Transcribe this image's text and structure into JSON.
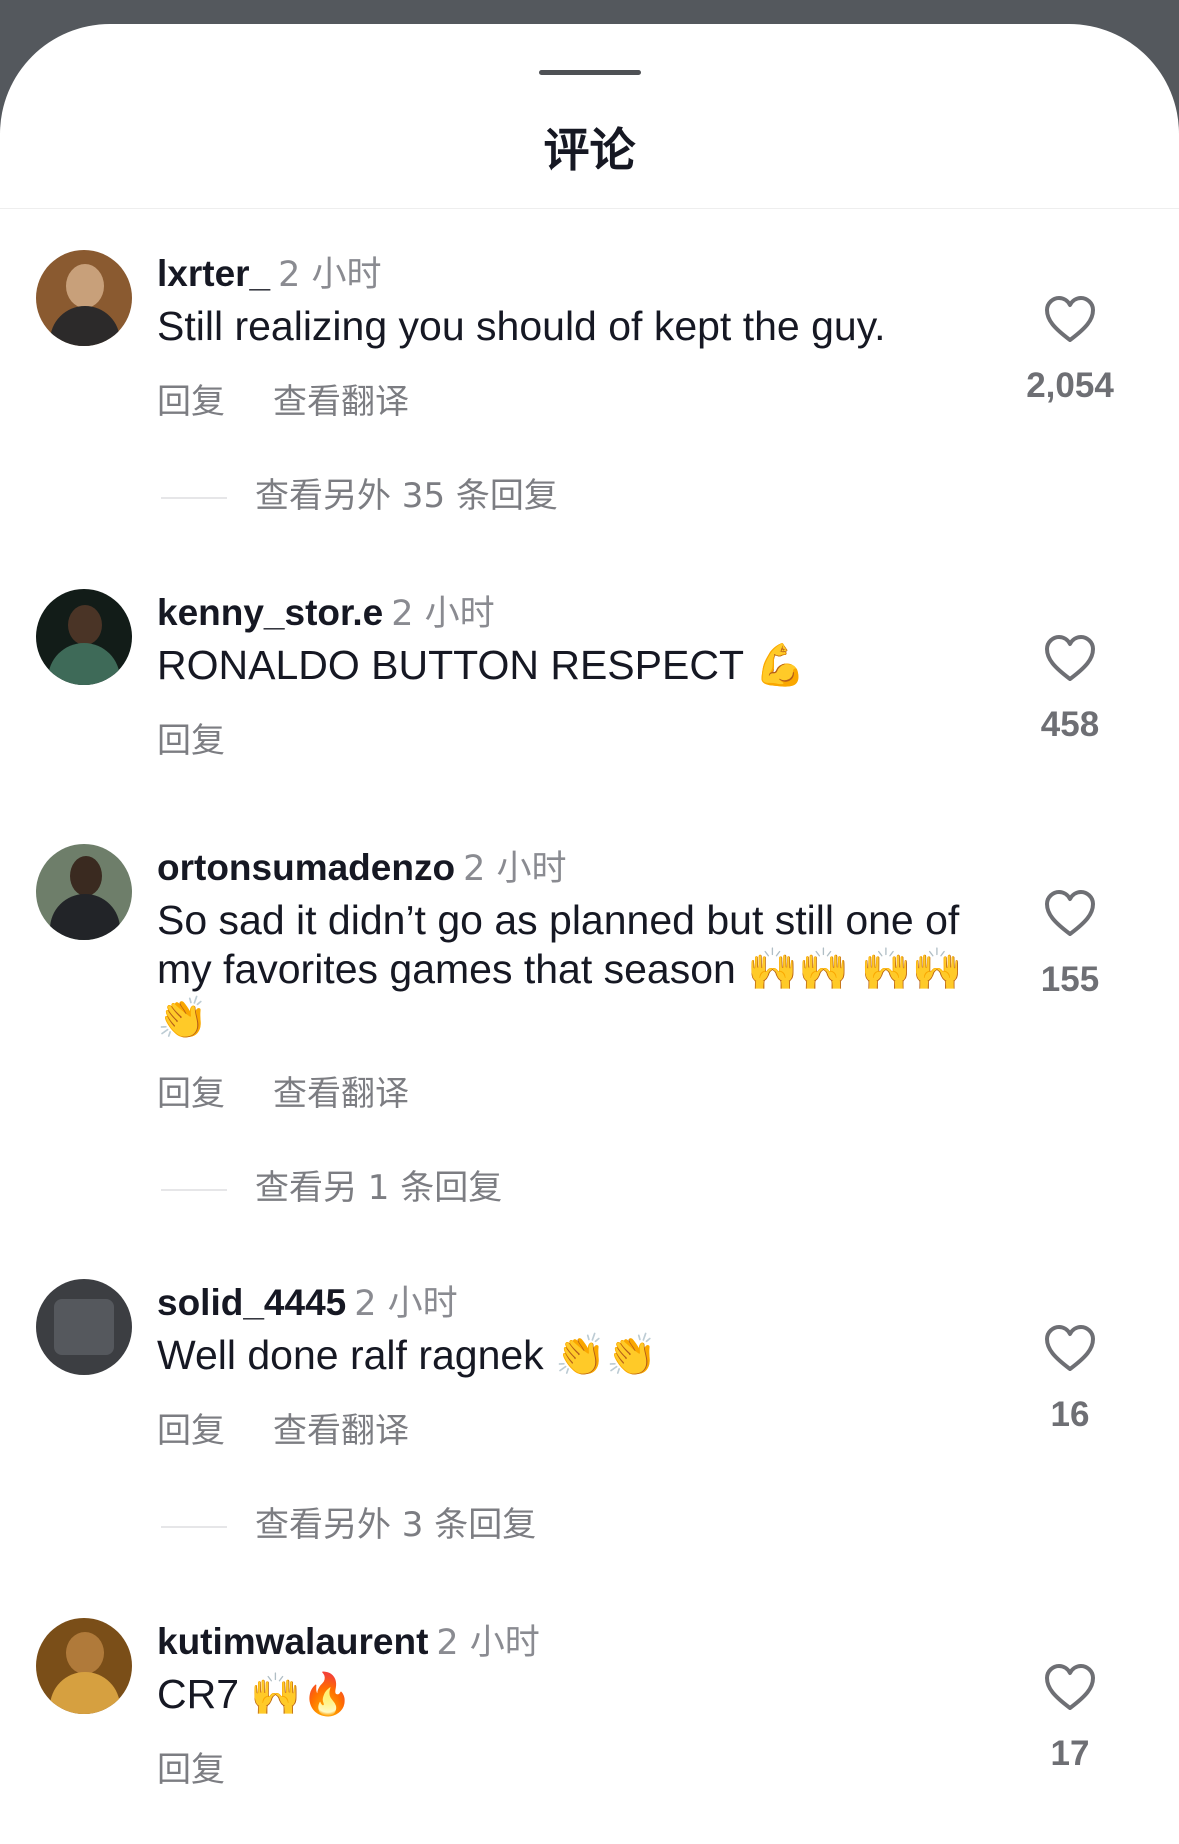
{
  "title": "评论",
  "actions": {
    "reply": "回复",
    "translate": "查看翻译"
  },
  "comments": [
    {
      "username": "lxrter_",
      "time": "2 小时",
      "text": "Still realizing you should of kept the guy.",
      "likes": "2,054",
      "replies": "查看另外 35 条回复",
      "has_translate": true,
      "avatar_color": "#7a4a2a"
    },
    {
      "username": "kenny_stor.e",
      "time": "2 小时",
      "text": "RONALDO BUTTON RESPECT 💪",
      "likes": "458",
      "replies": "",
      "has_translate": false,
      "avatar_color": "#1c2a22"
    },
    {
      "username": "ortonsumadenzo",
      "time": "2 小时",
      "text": "So sad it didn’t go as planned but still one of my favorites games that season 🙌🙌 🙌🙌👏",
      "likes": "155",
      "replies": "查看另 1 条回复",
      "has_translate": true,
      "avatar_color": "#5a6a58"
    },
    {
      "username": "solid_4445",
      "time": "2 小时",
      "text": "Well done ralf ragnek 👏👏",
      "likes": "16",
      "replies": "查看另外 3 条回复",
      "has_translate": true,
      "avatar_color": "#3b3d40"
    },
    {
      "username": "kutimwalaurent",
      "time": "2 小时",
      "text": "CR7 🙌🔥",
      "likes": "17",
      "replies": "",
      "has_translate": false,
      "avatar_color": "#8a5a1e"
    }
  ]
}
